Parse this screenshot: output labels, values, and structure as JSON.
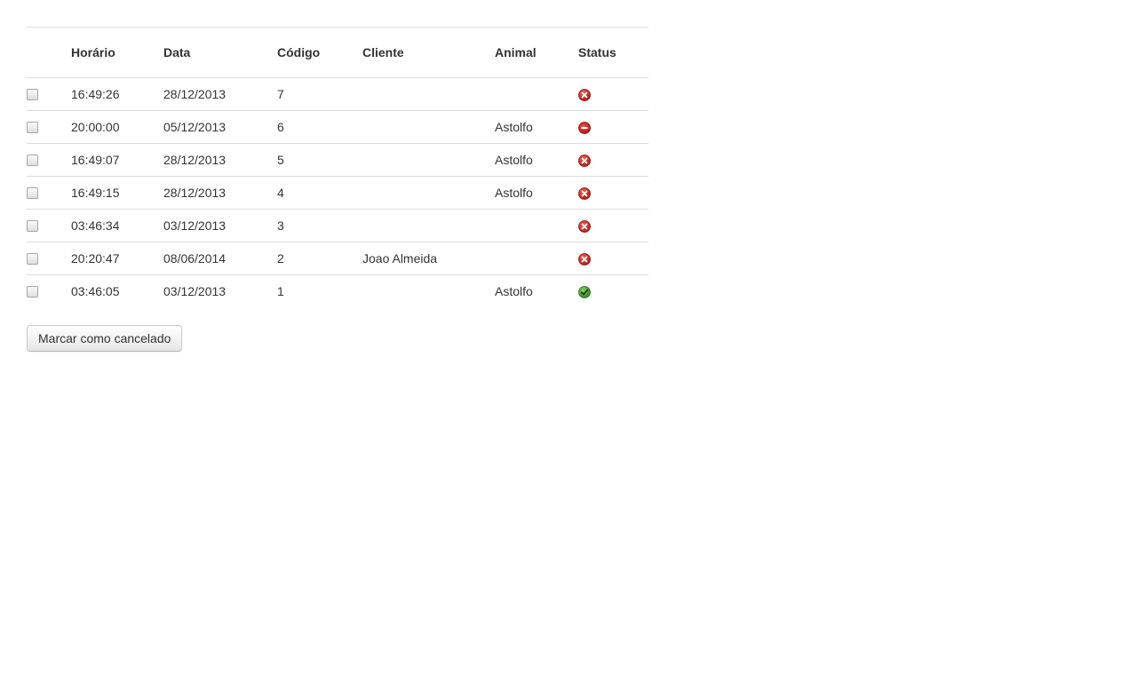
{
  "table": {
    "headers": [
      "",
      "Horário",
      "Data",
      "Código",
      "Cliente",
      "Animal",
      "Status"
    ],
    "rows": [
      {
        "time": "16:49:26",
        "date": "28/12/2013",
        "code": "7",
        "client": "",
        "animal": "",
        "status": "cancel-icon"
      },
      {
        "time": "20:00:00",
        "date": "05/12/2013",
        "code": "6",
        "client": "",
        "animal": "Astolfo",
        "status": "minus-circle-icon"
      },
      {
        "time": "16:49:07",
        "date": "28/12/2013",
        "code": "5",
        "client": "",
        "animal": "Astolfo",
        "status": "cancel-icon"
      },
      {
        "time": "16:49:15",
        "date": "28/12/2013",
        "code": "4",
        "client": "",
        "animal": "Astolfo",
        "status": "cancel-icon"
      },
      {
        "time": "03:46:34",
        "date": "03/12/2013",
        "code": "3",
        "client": "",
        "animal": "",
        "status": "cancel-icon"
      },
      {
        "time": "20:20:47",
        "date": "08/06/2014",
        "code": "2",
        "client": "Joao Almeida",
        "animal": "",
        "status": "cancel-icon"
      },
      {
        "time": "03:46:05",
        "date": "03/12/2013",
        "code": "1",
        "client": "",
        "animal": "Astolfo",
        "status": "check-icon"
      }
    ]
  },
  "actions": {
    "cancel_label": "Marcar como cancelado"
  },
  "colors": {
    "border": "#dddddd",
    "text": "#333333",
    "status_red": "#c9211e",
    "status_green": "#3d9a2b"
  }
}
